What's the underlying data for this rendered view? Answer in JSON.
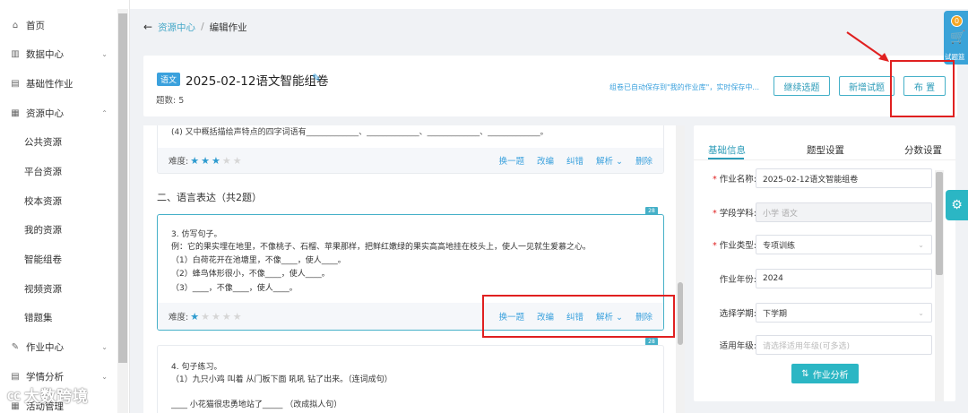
{
  "sidebar": {
    "items": [
      {
        "label": "首页",
        "icon": "home-icon",
        "glyph": "⌂"
      },
      {
        "label": "数据中心",
        "icon": "chart-icon",
        "glyph": "▥",
        "chevron": "⌄"
      },
      {
        "label": "基础性作业",
        "icon": "document-icon",
        "glyph": "▤"
      },
      {
        "label": "资源中心",
        "icon": "grid-icon",
        "glyph": "▦",
        "chevron": "⌃"
      }
    ],
    "subitems": [
      "公共资源",
      "平台资源",
      "校本资源",
      "我的资源",
      "智能组卷",
      "视频资源",
      "错题集"
    ],
    "items_bottom": [
      {
        "label": "作业中心",
        "icon": "edit-icon",
        "glyph": "✎",
        "chevron": "⌄"
      },
      {
        "label": "学情分析",
        "icon": "analysis-icon",
        "glyph": "▤",
        "chevron": "⌄"
      },
      {
        "label": "活动管理",
        "icon": "activity-icon",
        "glyph": "▦"
      }
    ]
  },
  "breadcrumb": {
    "back": "←",
    "root": "资源中心",
    "sep": "/",
    "current": "编辑作业"
  },
  "header": {
    "subject_tag": "语文",
    "title": "2025-02-12语文智能组卷",
    "count": "题数: 5",
    "save_tip": "组卷已自动保存到\"我的作业库\"，实时保存中...",
    "buttons": {
      "continue": "继续选题",
      "add": "新增试题",
      "publish": "布 置"
    }
  },
  "questions": {
    "q_prev_line": "(4) 又中概括描绘声特点的四字词语有_____________、_____________、_____________、_____________。",
    "difficulty_label": "难度:",
    "actions": [
      "换一题",
      "改编",
      "纠错",
      "解析 ⌄",
      "删除"
    ],
    "q_prev_stars": 3,
    "section2": "二、语言表达（共2题）",
    "q3": {
      "lines": [
        "3. 仿写句子。",
        "例：它的果实埋在地里，不像桃子、石榴、苹果那样，把鲜红嫩绿的果实高高地挂在枝头上，使人一见就生爱慕之心。",
        "（1）白荷花开在池塘里，不像____，使人____。",
        "（2）蜂鸟体形很小，不像____，使人____。",
        "（3）____，不像____，使人____。"
      ],
      "stars": 1
    },
    "q4": {
      "lines": [
        "4. 句子练习。",
        "（1）九只小鸡  叫着  从门板下面  吼吼  钻了出来。（连词成句）",
        "____  小花猫很忠勇地站了_____ （改成拟人句）"
      ]
    },
    "tag_text": "28"
  },
  "panel": {
    "tabs": [
      "基础信息",
      "题型设置",
      "分数设置"
    ],
    "fields": [
      {
        "label": "作业名称:",
        "required": true,
        "value": "2025-02-12语文智能组卷"
      },
      {
        "label": "学段学科:",
        "required": true,
        "value": "小学 语文",
        "disabled": true
      },
      {
        "label": "作业类型:",
        "required": true,
        "value": "专项训练",
        "dropdown": true
      },
      {
        "label": "作业年份:",
        "required": false,
        "value": "2024"
      },
      {
        "label": "选择学期:",
        "required": false,
        "value": "下学期",
        "dropdown": true
      },
      {
        "label": "适用年级:",
        "required": false,
        "placeholder": "请选择适用年级(可多选)"
      }
    ],
    "analysis_button": "作业分析",
    "analysis_glyph": "⇅"
  },
  "cart": {
    "badge": "0",
    "label": "试题篮",
    "glyph": "🛒"
  },
  "settings_glyph": "⚙",
  "watermark": "大数跨境",
  "watermark_logo": "㏄",
  "colors": {
    "accent": "#2b9bb8",
    "blue": "#3ba1dd",
    "red": "#e02020",
    "teal": "#2bb6c4"
  }
}
